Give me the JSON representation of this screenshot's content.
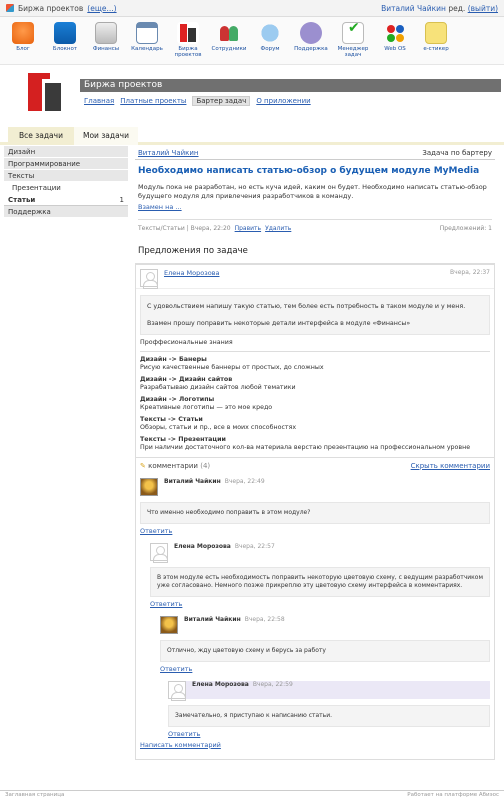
{
  "topbar": {
    "app_name": "Биржа проектов",
    "more": "(еще...)",
    "user": "Виталий Чайкин",
    "user_role": "ред.",
    "logout": "(выйти)"
  },
  "apps": [
    {
      "label": "Блог",
      "icon": "blog-icon"
    },
    {
      "label": "Блокнот",
      "icon": "notepad-icon"
    },
    {
      "label": "Финансы",
      "icon": "finance-icon"
    },
    {
      "label": "Календарь",
      "icon": "calendar-icon"
    },
    {
      "label": "Биржа проектов",
      "icon": "exchange-icon"
    },
    {
      "label": "Сотрудники",
      "icon": "staff-icon"
    },
    {
      "label": "Форум",
      "icon": "forum-icon"
    },
    {
      "label": "Поддержка",
      "icon": "support-icon"
    },
    {
      "label": "Менеджер задач",
      "icon": "tasks-icon"
    },
    {
      "label": "Web OS",
      "icon": "webos-icon"
    },
    {
      "label": "e-стикер",
      "icon": "sticker-icon"
    }
  ],
  "header": {
    "title": "Биржа проектов",
    "nav": [
      "Главная",
      "Платные проекты",
      "Бартер задач",
      "О приложении"
    ]
  },
  "tabs": [
    "Все задачи",
    "Мои задачи"
  ],
  "sidebar": {
    "items": [
      "Дизайн",
      "Программирование",
      "Тексты",
      "Презентации",
      "Статьи",
      "Поддержка"
    ],
    "selected_count": "1"
  },
  "task": {
    "author": "Виталий Чайкин",
    "type": "Задача по бартеру",
    "title": "Необходимо написать статью-обзор о будущем модуле MyMedia",
    "description": "Модуль пока не разработан, но есть куча идей, каким он будет. Необходимо написать статью-обзор будущего модуля для привлечения разработчиков в команду.",
    "more": "Взамен на ...",
    "meta": "Тексты/Статьи | Вчера, 22:20",
    "edit": "Править",
    "delete": "Удалить",
    "offers_count": "Предложений: 1"
  },
  "offers_title": "Предложения по задаче",
  "offer": {
    "name": "Елена Морозова",
    "time": "Вчера, 22:37",
    "text1": "С удовольствием напишу такую статью, тем более есть потребность в таком модуле и у меня.",
    "text2": "Взамен прошу поправить некоторые детали интерфейса в модуле «Финансы»",
    "skills_title": "Проффесиональные знания",
    "skills": [
      {
        "t": "Дизайн -> Банеры",
        "d": "Рисую качественные баннеры от простых, до сложных"
      },
      {
        "t": "Дизайн -> Дизайн сайтов",
        "d": "Разрабатываю дизайн сайтов любой тематики"
      },
      {
        "t": "Дизайн -> Логотипы",
        "d": "Креативные логотипы — это мое кредо"
      },
      {
        "t": "Тексты -> Статьи",
        "d": "Обзоры, статьи и пр., все в моих способностях"
      },
      {
        "t": "Тексты -> Презентации",
        "d": "При наличии достаточного кол-ва материала верстаю презентацию на профессиональном уровне"
      }
    ]
  },
  "comments": {
    "label": "комментарии",
    "count": "(4)",
    "hide": "Скрыть комментарии",
    "reply": "Ответить",
    "write": "Написать комментарий",
    "items": [
      {
        "name": "Виталий Чайкин",
        "time": "Вчера, 22:49",
        "text": "Что именно необходимо поправить в этом модуле?"
      },
      {
        "name": "Елена Морозова",
        "time": "Вчера, 22:57",
        "text": "В этом модуле есть необходимость поправить некоторую цветовую схему, с ведущим разработчиком уже согласовано. Немного позже прикреплю эту цветовую схему интерфейса в комментариях."
      },
      {
        "name": "Виталий Чайкин",
        "time": "Вчера, 22:58",
        "text": "Отлично, жду цветовую схему и берусь за работу"
      },
      {
        "name": "Елена Морозова",
        "time": "Вчера, 22:59",
        "text": "Замечательно, я приступаю к написанию статьи."
      }
    ]
  },
  "footer": {
    "left": "Заглавная страница",
    "right": "Работает на платформе Абиэос"
  }
}
